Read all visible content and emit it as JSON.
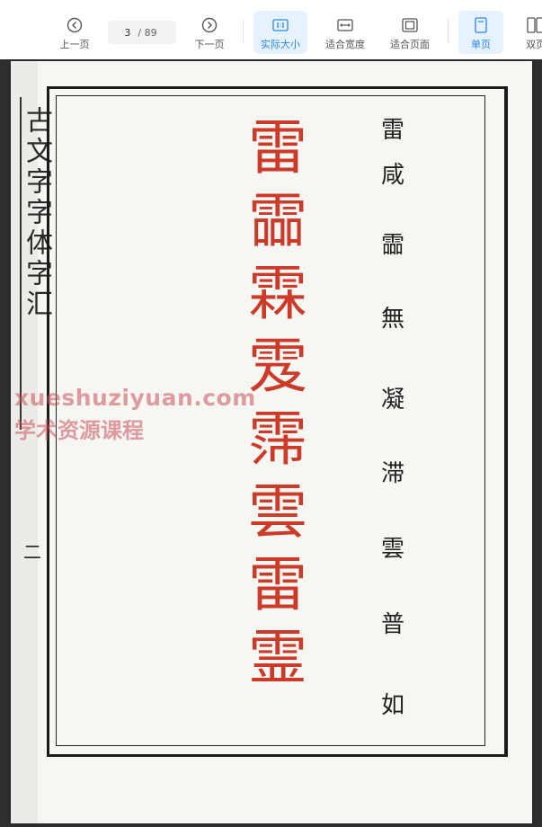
{
  "toolbar": {
    "prev_label": "上一页",
    "next_label": "下一页",
    "current_page": "3",
    "total_pages": "/ 89",
    "actual_size_label": "实际大小",
    "fit_width_label": "适合宽度",
    "fit_page_label": "适合页面",
    "single_page_label": "单页",
    "double_page_label": "双页"
  },
  "document": {
    "margin_text": "古文字字体字汇",
    "margin_page_num": "二",
    "seal_characters": [
      "雷",
      "霝",
      "霖",
      "雭",
      "霈",
      "雲",
      "雷",
      "霊"
    ],
    "small_characters": [
      "雷",
      "咸",
      "霝",
      "無",
      "凝",
      "滞",
      "雲",
      "普",
      "如"
    ]
  },
  "watermark": {
    "line1": "xueshuziyuan.com",
    "line2": "学术资源课程"
  },
  "colors": {
    "accent": "#2a86e6",
    "seal_red": "#cc3a2a"
  }
}
